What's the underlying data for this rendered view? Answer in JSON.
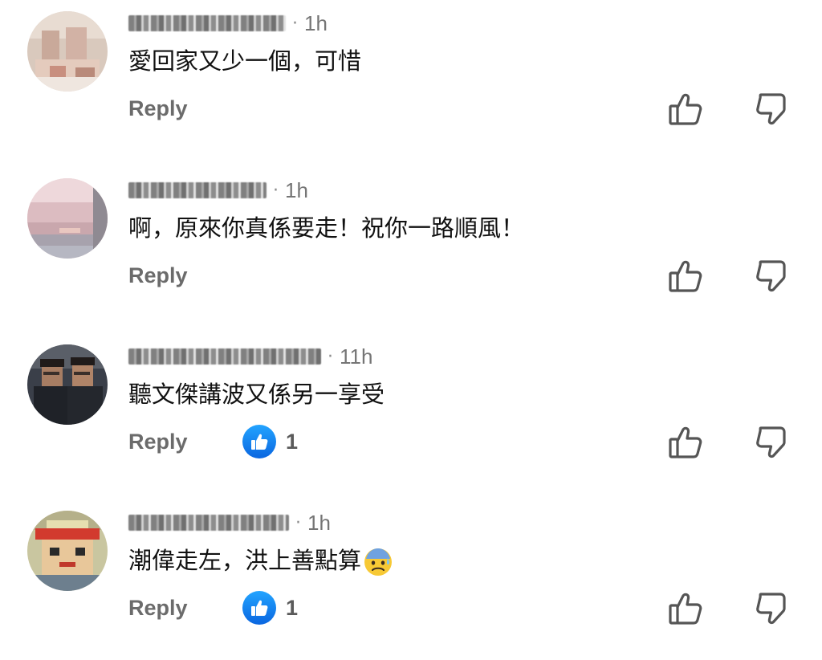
{
  "colors": {
    "like_blue": "#1877f2",
    "secondary_text": "#757575",
    "reply_text": "#6b6b6b",
    "body_text": "#111111"
  },
  "comments": [
    {
      "author": "",
      "timestamp": "1h",
      "text": "愛回家又少一個，可惜",
      "reply_label": "Reply",
      "reaction_count": null,
      "emoji": null
    },
    {
      "author": "",
      "timestamp": "1h",
      "text": "啊，原來你真係要走！祝你一路順風！",
      "reply_label": "Reply",
      "reaction_count": null,
      "emoji": null
    },
    {
      "author": "",
      "timestamp": "11h",
      "text": "聽文傑講波又係另一享受",
      "reply_label": "Reply",
      "reaction_count": "1",
      "emoji": null
    },
    {
      "author": "",
      "timestamp": "1h",
      "text": "潮偉走左，洪上善點算",
      "reply_label": "Reply",
      "reaction_count": "1",
      "emoji": "anxious-sweat-face-icon"
    }
  ]
}
